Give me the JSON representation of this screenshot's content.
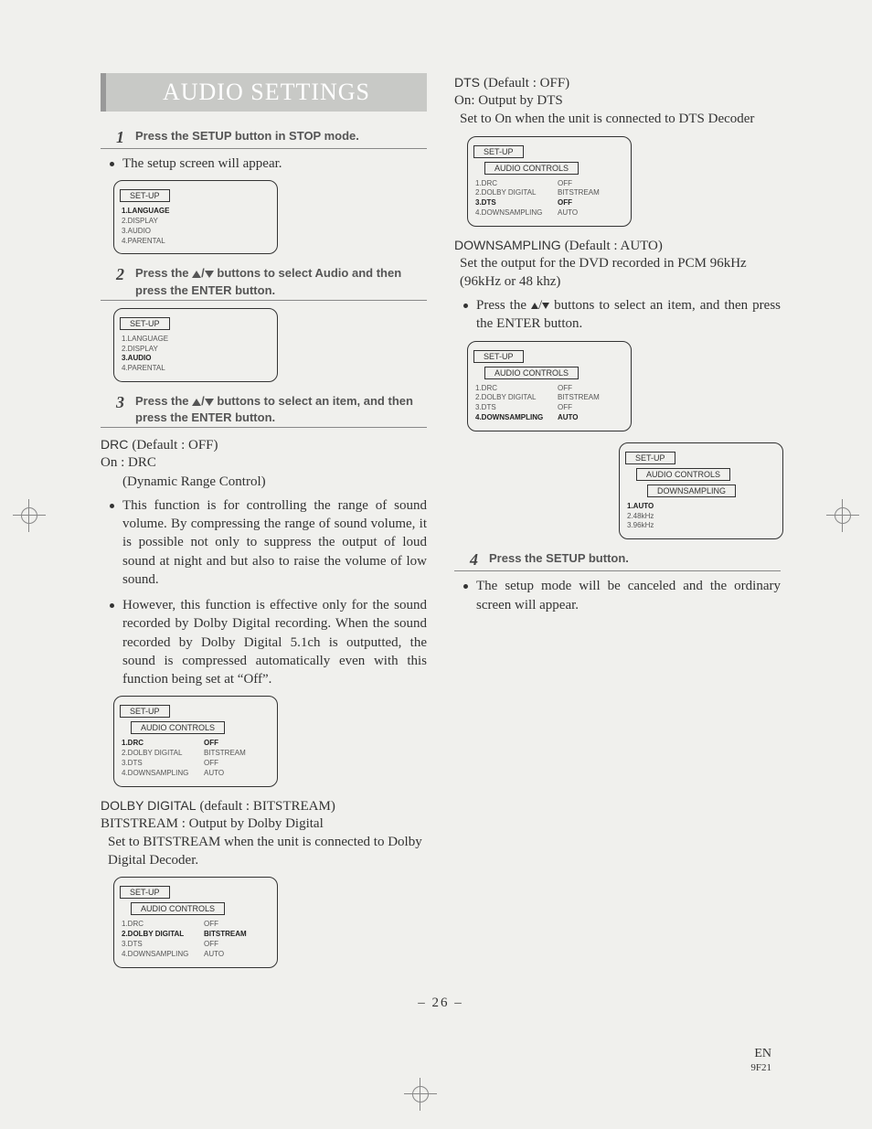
{
  "title": "AUDIO SETTINGS",
  "page_number": "– 26 –",
  "footer_lang": "EN",
  "footer_code": "9F21",
  "steps": {
    "s1": {
      "num": "1",
      "text": "Press the SETUP button in STOP mode."
    },
    "s1_follow": "The setup screen will appear.",
    "s2": {
      "num": "2",
      "pre": "Press the ",
      "post": " buttons to select Audio and then press the ENTER button."
    },
    "s3": {
      "num": "3",
      "pre": "Press the ",
      "post": " buttons to select an item, and then press the ENTER button."
    },
    "s4": {
      "num": "4",
      "text": "Press the SETUP button."
    },
    "s4_follow": "The setup mode will be canceled and the ordinary screen will appear."
  },
  "drc": {
    "head_name": "DRC",
    "head_def": "(Default : OFF)",
    "line1": "On : DRC",
    "line2": "(Dynamic Range Control)",
    "para1": "This function is for controlling the range of sound volume.  By compressing the range of sound volume, it is possible not only to suppress the output of loud sound at night and but also to raise the volume of low sound.",
    "para2": "However, this function is effective only for the sound recorded by Dolby Digital recording.  When the sound recorded by Dolby Digital 5.1ch is outputted, the sound is compressed automatically even with this function being set at “Off”."
  },
  "dolby": {
    "head_name": "DOLBY DIGITAL",
    "head_def": "(default : BITSTREAM)",
    "line1": "BITSTREAM : Output by Dolby Digital",
    "line2": "Set to BITSTREAM when the unit is connected to Dolby Digital Decoder."
  },
  "dts": {
    "head_name": "DTS",
    "head_def": "(Default : OFF)",
    "line1": "On: Output by DTS",
    "line2": "Set to On when the unit is connected to DTS Decoder"
  },
  "down": {
    "head_name": "DOWNSAMPLING",
    "head_def": "(Default : AUTO)",
    "line1": "Set the output for the DVD recorded in PCM 96kHz (96kHz or 48 khz)",
    "bullet_pre": "Press the ",
    "bullet_post": " buttons to select an item, and then press the ENTER button."
  },
  "screen_labels": {
    "setup": "SET-UP",
    "audio_controls": "AUDIO CONTROLS",
    "downsampling": "DOWNSAMPLING"
  },
  "screen1": {
    "i1": "1.LANGUAGE",
    "i2": "2.DISPLAY",
    "i3": "3.AUDIO",
    "i4": "4.PARENTAL"
  },
  "screen_audio": {
    "r1a": "1.DRC",
    "r1b": "OFF",
    "r2a": "2.DOLBY DIGITAL",
    "r2b": "BITSTREAM",
    "r3a": "3.DTS",
    "r3b": "OFF",
    "r4a": "4.DOWNSAMPLING",
    "r4b": "AUTO"
  },
  "screen_down": {
    "i1": "1.AUTO",
    "i2": "2.48kHz",
    "i3": "3.96kHz"
  }
}
